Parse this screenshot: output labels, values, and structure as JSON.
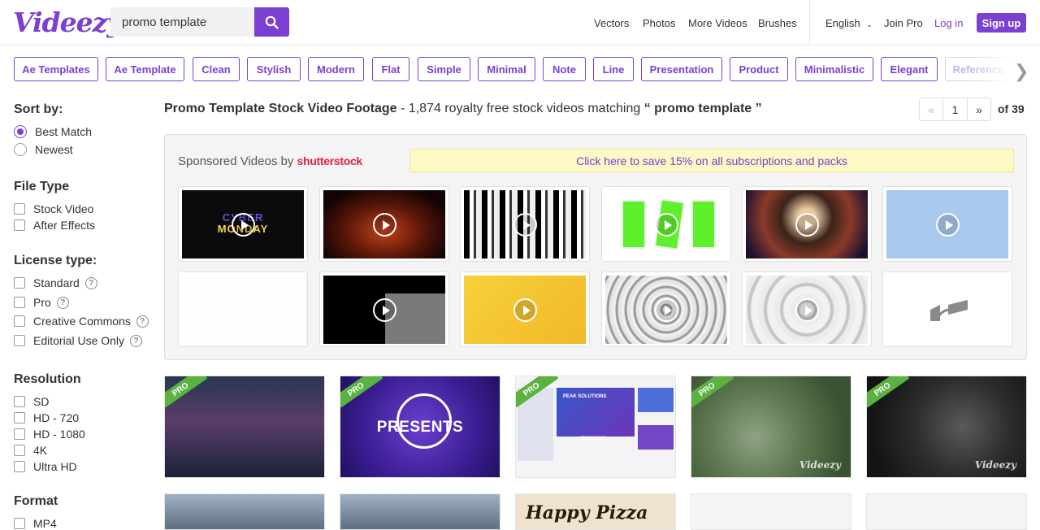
{
  "header": {
    "logo": "Videezy",
    "search_value": "promo template",
    "nav": [
      "Vectors",
      "Photos",
      "More Videos",
      "Brushes"
    ],
    "language": "English",
    "join_pro": "Join Pro",
    "login": "Log in",
    "signup": "Sign up"
  },
  "tags": [
    "Ae Templates",
    "Ae Template",
    "Clean",
    "Stylish",
    "Modern",
    "Flat",
    "Simple",
    "Minimal",
    "Note",
    "Line",
    "Presentation",
    "Product",
    "Minimalistic",
    "Elegant",
    "Reference"
  ],
  "sidebar": {
    "sort_heading": "Sort by:",
    "sort_options": [
      "Best Match",
      "Newest"
    ],
    "file_heading": "File Type",
    "file_options": [
      "Stock Video",
      "After Effects"
    ],
    "license_heading": "License type:",
    "license_options": [
      "Standard",
      "Pro",
      "Creative Commons",
      "Editorial Use Only"
    ],
    "resolution_heading": "Resolution",
    "resolution_options": [
      "SD",
      "HD - 720",
      "HD - 1080",
      "4K",
      "Ultra HD"
    ],
    "format_heading": "Format",
    "format_options": [
      "MP4"
    ]
  },
  "results": {
    "title": "Promo Template Stock Video Footage",
    "summary_prefix": " - 1,874 royalty free stock videos matching ",
    "query_display": "“ promo template ”",
    "page_prev": "«",
    "page_current": "1",
    "page_next": "»",
    "page_total": "of 39"
  },
  "sponsored": {
    "label": "Sponsored Videos by ",
    "brand": "shutterstock",
    "promo": "Click here to save 15% on all subscriptions and packs",
    "thumb1_text_top": "CYBER",
    "thumb1_text_bottom": "MONDAY"
  },
  "cards": {
    "badge": "PRO",
    "watermark": "Videezy",
    "card2_text": "PRESENTS",
    "card3_text_a": "PEAK SOLUTIONS",
    "card3_text_b": "DIVISIONS",
    "bottom3_text": "Happy Pizza"
  },
  "colors": {
    "brand": "#7b3fd1",
    "pro_badge": "#5bb141",
    "promo_bg": "#fdf8c4"
  }
}
